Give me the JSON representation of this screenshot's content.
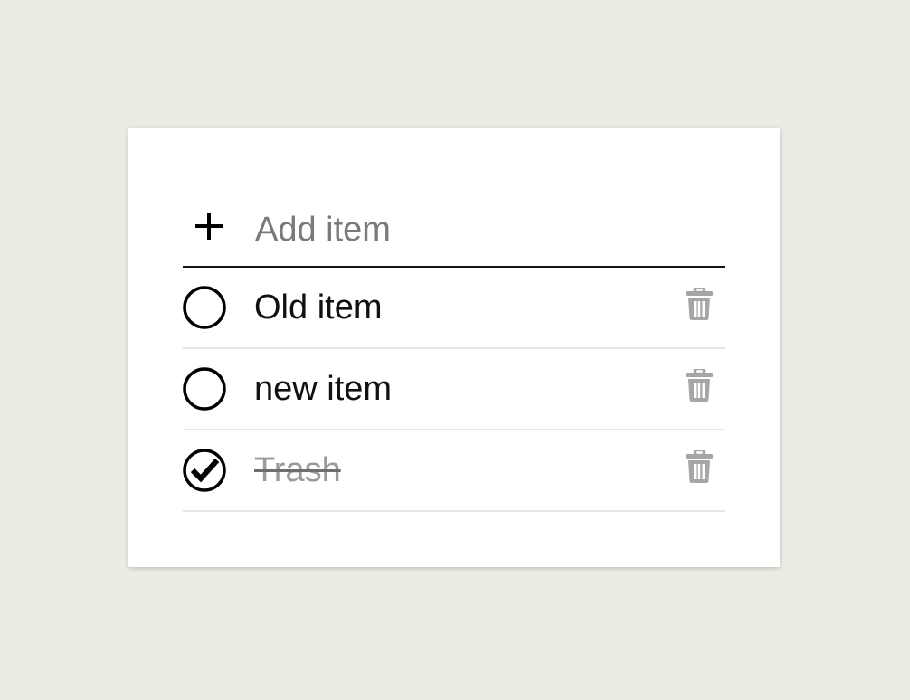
{
  "add_item": {
    "placeholder": "Add item",
    "value": ""
  },
  "items": [
    {
      "label": "Old item",
      "completed": false
    },
    {
      "label": "new item",
      "completed": false
    },
    {
      "label": "Trash",
      "completed": true
    }
  ],
  "icons": {
    "add": "plus-icon",
    "unchecked": "circle-icon",
    "checked": "check-circle-icon",
    "delete": "trash-icon"
  },
  "colors": {
    "background": "#ecebe4",
    "card": "#ffffff",
    "text": "#111111",
    "muted": "#9a9a9a",
    "icon_muted": "#a6a6a6",
    "divider": "#e6e6e6"
  }
}
